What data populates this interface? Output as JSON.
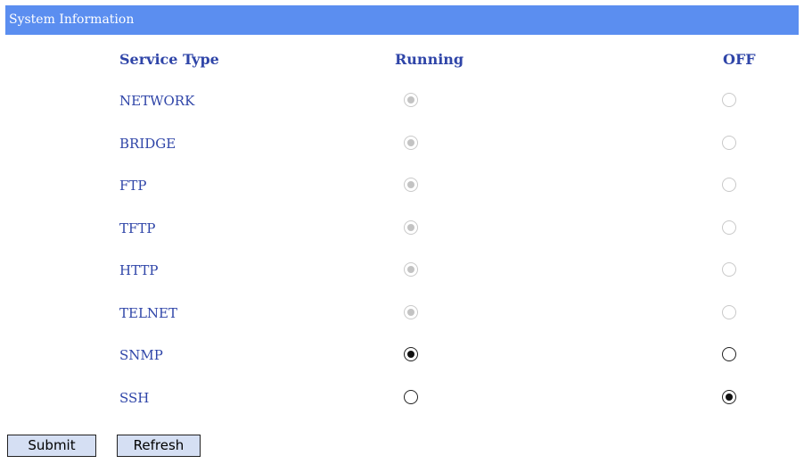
{
  "panel": {
    "title": "System Information"
  },
  "table": {
    "headers": {
      "service_type": "Service Type",
      "running": "Running",
      "off": "OFF"
    },
    "rows": [
      {
        "name": "NETWORK",
        "selected": "running",
        "enabled": false
      },
      {
        "name": "BRIDGE",
        "selected": "running",
        "enabled": false
      },
      {
        "name": "FTP",
        "selected": "running",
        "enabled": false
      },
      {
        "name": "TFTP",
        "selected": "running",
        "enabled": false
      },
      {
        "name": "HTTP",
        "selected": "running",
        "enabled": false
      },
      {
        "name": "TELNET",
        "selected": "running",
        "enabled": false
      },
      {
        "name": "SNMP",
        "selected": "running",
        "enabled": true
      },
      {
        "name": "SSH",
        "selected": "off",
        "enabled": true
      }
    ]
  },
  "buttons": {
    "submit_label": "Submit",
    "refresh_label": "Refresh"
  },
  "colors": {
    "title_bar": "#5b8ef0",
    "label_text": "#2f45a8",
    "button_bg": "#d5dff3"
  }
}
